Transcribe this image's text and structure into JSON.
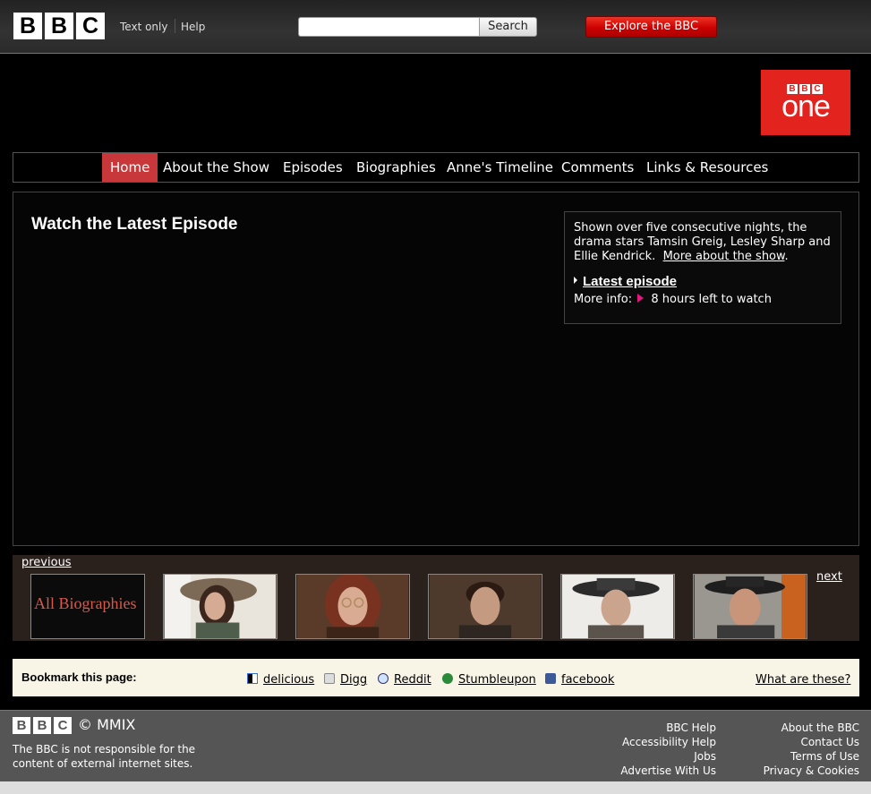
{
  "topbar": {
    "logo_letters": [
      "B",
      "B",
      "C"
    ],
    "text_only": "Text only",
    "help": "Help",
    "search_placeholder": "",
    "search_button": "Search",
    "explore_button": "Explore the BBC"
  },
  "channel_logo": {
    "letters": [
      "B",
      "B",
      "C"
    ],
    "word": "one",
    "color": "#e3231e"
  },
  "nav": {
    "items": [
      {
        "label": "Home",
        "active": true
      },
      {
        "label": "About the Show"
      },
      {
        "label": "Episodes"
      },
      {
        "label": "Biographies"
      },
      {
        "label": "Anne's Timeline"
      },
      {
        "label": "Comments"
      },
      {
        "label": "Links & Resources"
      }
    ],
    "active_color": "#c8383a"
  },
  "main": {
    "heading": "Watch the Latest Episode",
    "info": {
      "text": "Shown over five consecutive nights, the drama stars Tamsin Greig, Lesley Sharp and Ellie Kendrick.",
      "more_link": "More about the show",
      "latest_link": "Latest episode",
      "more_info_label": "More info:",
      "time_left": "8 hours left to watch"
    }
  },
  "carousel": {
    "previous": "previous",
    "next": "next",
    "all_biographies": "All Biographies"
  },
  "bookmark": {
    "label": "Bookmark this page:",
    "links": [
      "delicious",
      "Digg",
      "Reddit",
      "Stumbleupon",
      "facebook"
    ],
    "what": "What are these?"
  },
  "footer": {
    "logo_letters": [
      "B",
      "B",
      "C"
    ],
    "copyright": "© MMIX",
    "disclaimer": "The BBC is not responsible for the content of external internet sites.",
    "col1": [
      "BBC Help",
      "Accessibility Help",
      "Jobs",
      "Advertise With Us"
    ],
    "col2": [
      "About the BBC",
      "Contact Us",
      "Terms of Use",
      "Privacy & Cookies"
    ]
  }
}
